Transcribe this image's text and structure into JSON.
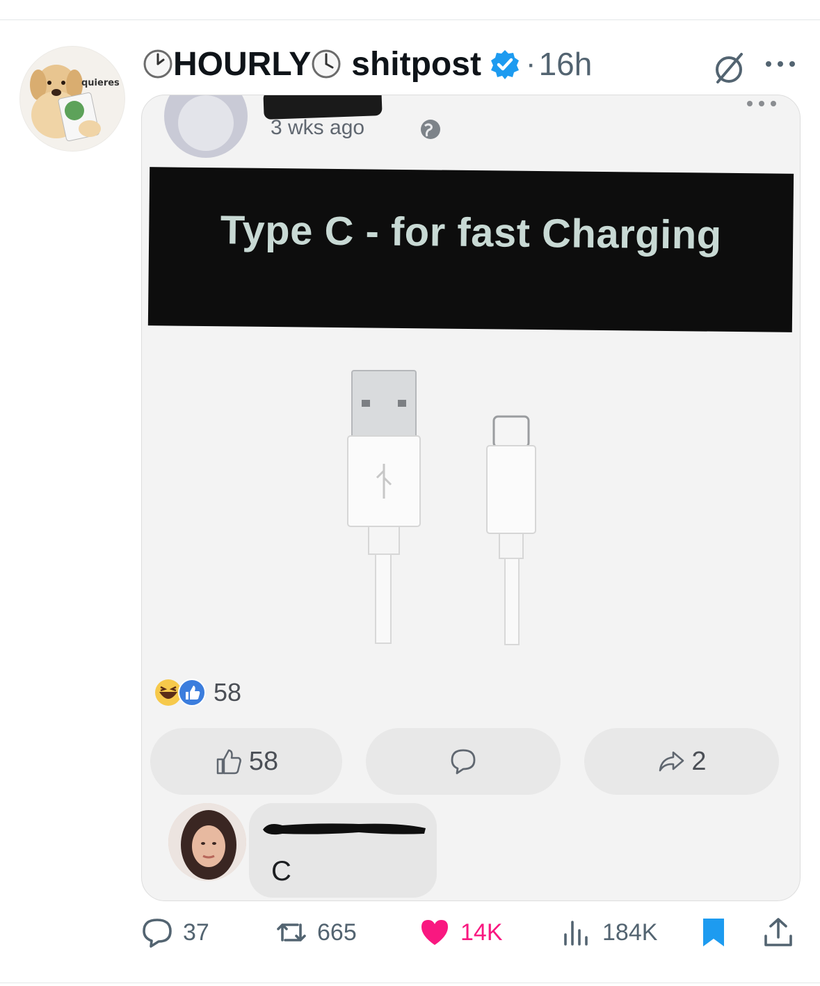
{
  "tweet": {
    "author_name": "HOURLY",
    "author_name_suffix": "shitpost",
    "timestamp": "16h",
    "avatar_caption": "quieres",
    "verified_color": "#1d9bf0"
  },
  "embedded_post": {
    "time": "3 wks ago",
    "banner_text": "Type C - for fast Charging",
    "reactions_count": "58",
    "like_count": "58",
    "share_count": "2",
    "comment_text": "C"
  },
  "actions": {
    "replies": "37",
    "retweets": "665",
    "likes": "14K",
    "views": "184K",
    "like_color": "#f91880",
    "bookmark_color": "#1d9bf0"
  }
}
